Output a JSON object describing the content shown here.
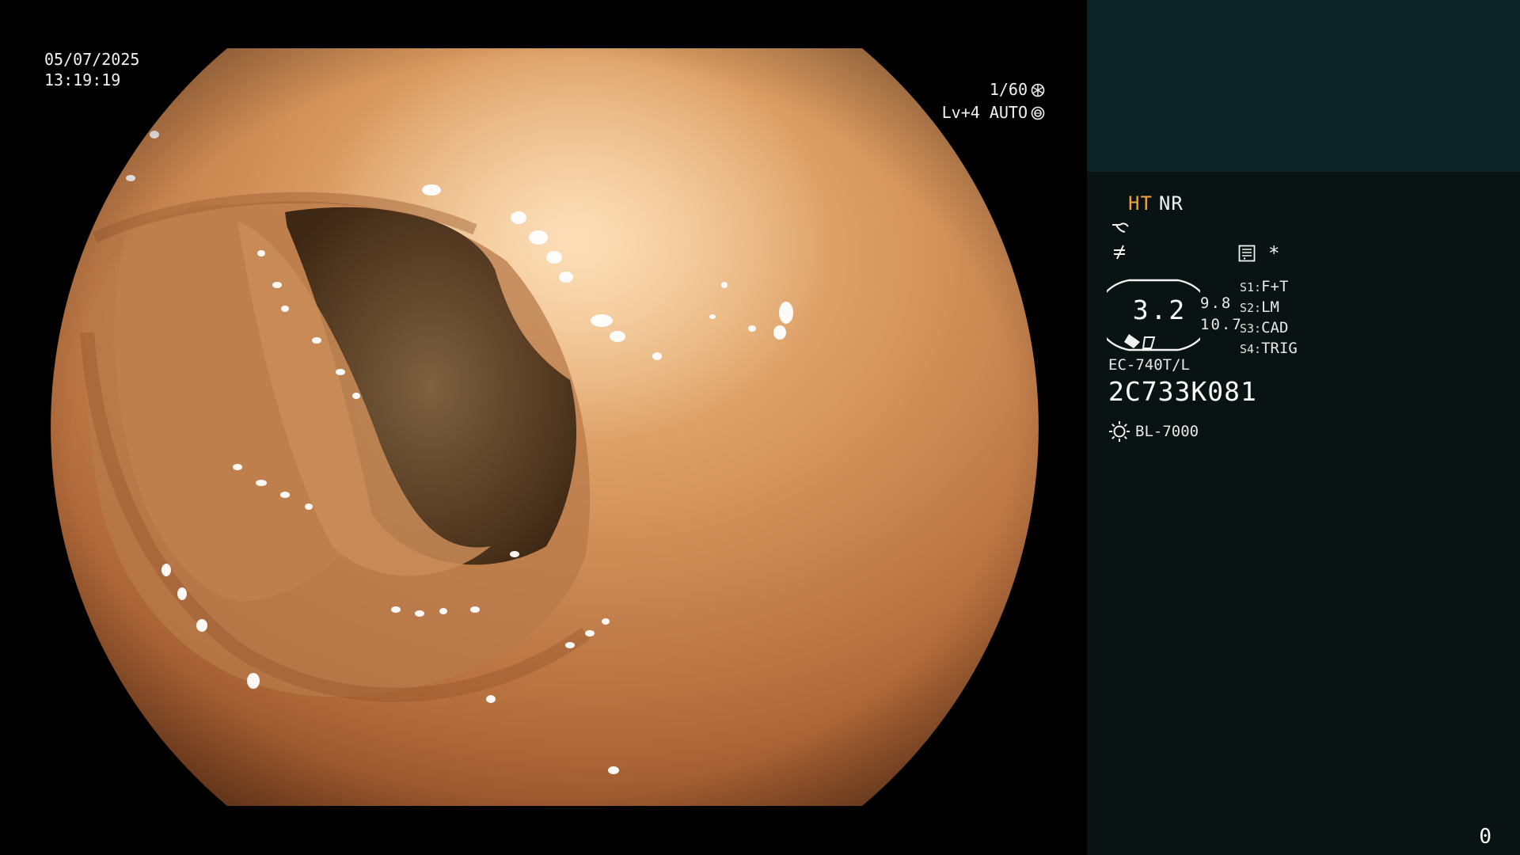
{
  "capture": {
    "date": "05/07/2025",
    "time": "13:19:19",
    "shutter": "1/60",
    "iris": "Lv+4 AUTO"
  },
  "modes": {
    "ht": "HT",
    "nr": "NR",
    "ht_color": "#f2a33a"
  },
  "icons": {
    "structure": "structure-enhance-icon",
    "color": "color-enhance-icon",
    "menu": "menu-list-icon",
    "star": "*"
  },
  "zoom": {
    "value": "3.2",
    "enhance_1": "9.8",
    "enhance_2": "10.7"
  },
  "switches": [
    {
      "key": "S1:",
      "value": "F+T"
    },
    {
      "key": "S2:",
      "value": "LM"
    },
    {
      "key": "S3:",
      "value": "CAD"
    },
    {
      "key": "S4:",
      "value": "TRIG"
    }
  ],
  "scope": {
    "model": "EC-740T/L",
    "serial": "2C733K081"
  },
  "light_source": {
    "name": "BL-7000"
  },
  "counter": "0",
  "colors": {
    "panel_bg": "#0a1314",
    "thumb_bg": "#0c2325",
    "tissue_base": "#c9844f"
  }
}
